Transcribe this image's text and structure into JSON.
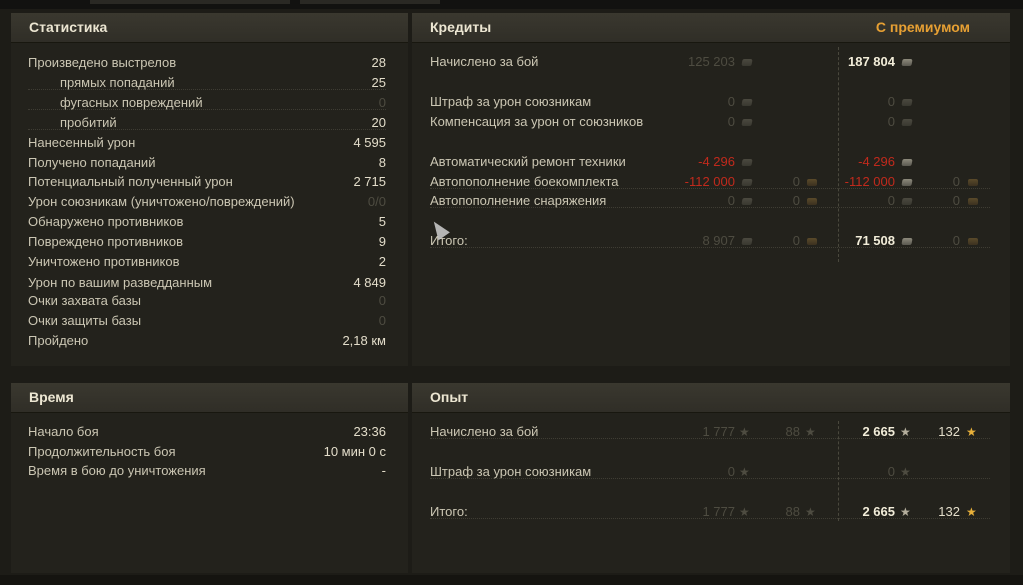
{
  "stats": {
    "title": "Статистика",
    "rows": [
      {
        "label": "Произведено выстрелов",
        "value": "28"
      },
      {
        "label": "прямых попаданий",
        "value": "25"
      },
      {
        "label": "фугасных повреждений",
        "value": "0"
      },
      {
        "label": "пробитий",
        "value": "20"
      },
      {
        "label": "Нанесенный урон",
        "value": "4 595"
      },
      {
        "label": "Получено попаданий",
        "value": "8"
      },
      {
        "label": "Потенциальный полученный урон",
        "value": "2 715"
      },
      {
        "label": "Урон союзникам (уничтожено/повреждений)",
        "value": "0/0"
      },
      {
        "label": "Обнаружено противников",
        "value": "5"
      },
      {
        "label": "Повреждено противников",
        "value": "9"
      },
      {
        "label": "Уничтожено противников",
        "value": "2"
      },
      {
        "label": "Урон по вашим разведданным",
        "value": "4 849"
      },
      {
        "label": "Очки захвата базы",
        "value": "0"
      },
      {
        "label": "Очки защиты базы",
        "value": "0"
      },
      {
        "label": "Пройдено",
        "value": "2,18 км"
      }
    ]
  },
  "time": {
    "title": "Время",
    "rows": [
      {
        "label": "Начало боя",
        "value": "23:36"
      },
      {
        "label": "Продолжительность боя",
        "value": "10 мин 0 с"
      },
      {
        "label": "Время в бою до уничтожения",
        "value": "-"
      }
    ]
  },
  "credits": {
    "title": "Кредиты",
    "premium_label": "С премиумом",
    "rows": [
      {
        "label": "Начислено за бой",
        "base": "125 203",
        "base_gold": "",
        "prem": "187 804",
        "prem_gold": ""
      },
      {
        "label": "Штраф за урон союзникам",
        "base": "0",
        "base_gold": "",
        "prem": "0",
        "prem_gold": ""
      },
      {
        "label": "Компенсация за урон от союзников",
        "base": "0",
        "base_gold": "",
        "prem": "0",
        "prem_gold": ""
      },
      {
        "label": "Автоматический ремонт техники",
        "base": "-4 296",
        "base_gold": "",
        "prem": "-4 296",
        "prem_gold": ""
      },
      {
        "label": "Автопополнение боекомплекта",
        "base": "-112 000",
        "base_gold": "0",
        "prem": "-112 000",
        "prem_gold": "0"
      },
      {
        "label": "Автопополнение снаряжения",
        "base": "0",
        "base_gold": "0",
        "prem": "0",
        "prem_gold": "0"
      },
      {
        "label": "Итого:",
        "base": "8 907",
        "base_gold": "0",
        "prem": "71 508",
        "prem_gold": "0"
      }
    ]
  },
  "experience": {
    "title": "Опыт",
    "rows": [
      {
        "label": "Начислено за бой",
        "base": "1 777",
        "base_free": "88",
        "prem": "2 665",
        "prem_free": "132"
      },
      {
        "label": "Штраф за урон союзникам",
        "base": "0",
        "base_free": "",
        "prem": "0",
        "prem_free": ""
      },
      {
        "label": "Итого:",
        "base": "1 777",
        "base_free": "88",
        "prem": "2 665",
        "prem_free": "132"
      }
    ]
  },
  "icons": {
    "credit": "credit-coin-icon",
    "gold": "gold-icon",
    "xp": "xp-star-icon",
    "free_xp": "free-xp-star-icon"
  },
  "colors": {
    "accent": "#e7a033",
    "negative": "#c12a1c",
    "dim": "#4e4c41",
    "text": "#cbc6b3"
  }
}
